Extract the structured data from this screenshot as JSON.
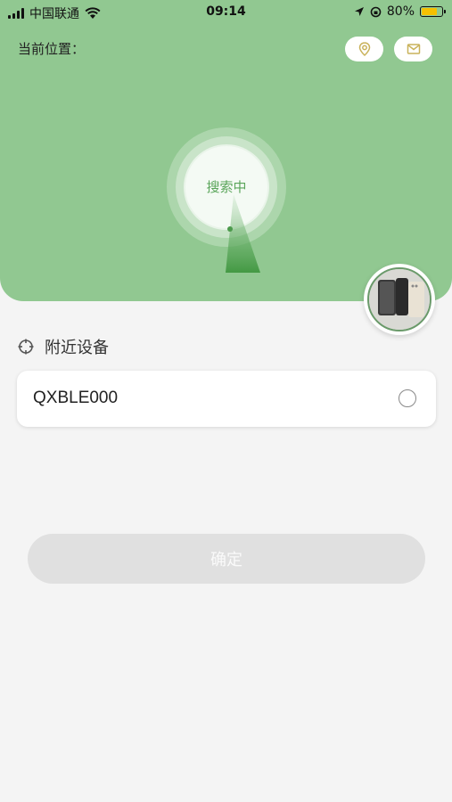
{
  "status_bar": {
    "carrier": "中国联通",
    "time": "09:14",
    "battery_percent": "80%",
    "battery_level": 0.8,
    "icons": [
      "signal-icon",
      "wifi-icon",
      "location-arrow-icon",
      "rotation-lock-icon",
      "battery-icon"
    ]
  },
  "header": {
    "location_label": "当前位置：",
    "buttons": [
      {
        "name": "location-pin-button",
        "icon": "location-pin-icon"
      },
      {
        "name": "message-button",
        "icon": "envelope-icon"
      }
    ],
    "radar_label": "搜索中",
    "colors": {
      "header_bg": "#91c891",
      "accent": "#5aa55a"
    }
  },
  "nearby": {
    "title": "附近设备",
    "icon": "crosshair-icon",
    "devices": [
      {
        "name": "QXBLE000",
        "selected": false
      }
    ]
  },
  "confirm_label": "确定"
}
